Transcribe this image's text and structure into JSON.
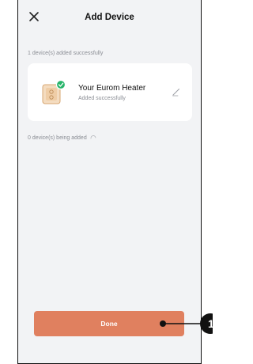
{
  "header": {
    "title": "Add Device",
    "close_icon": "close-icon"
  },
  "sections": {
    "success_label": "1 device(s) added successfully",
    "adding_label": "0 device(s) being added"
  },
  "device": {
    "name": "Your Eurom Heater",
    "status": "Added successfully",
    "icon": "heater-device-icon",
    "status_icon": "check-badge-icon",
    "edit_icon": "pencil-icon"
  },
  "footer": {
    "done_label": "Done"
  },
  "callout": {
    "number": "1"
  },
  "colors": {
    "accent": "#e0805f",
    "background": "#f2f3f5",
    "success": "#27b46a"
  }
}
